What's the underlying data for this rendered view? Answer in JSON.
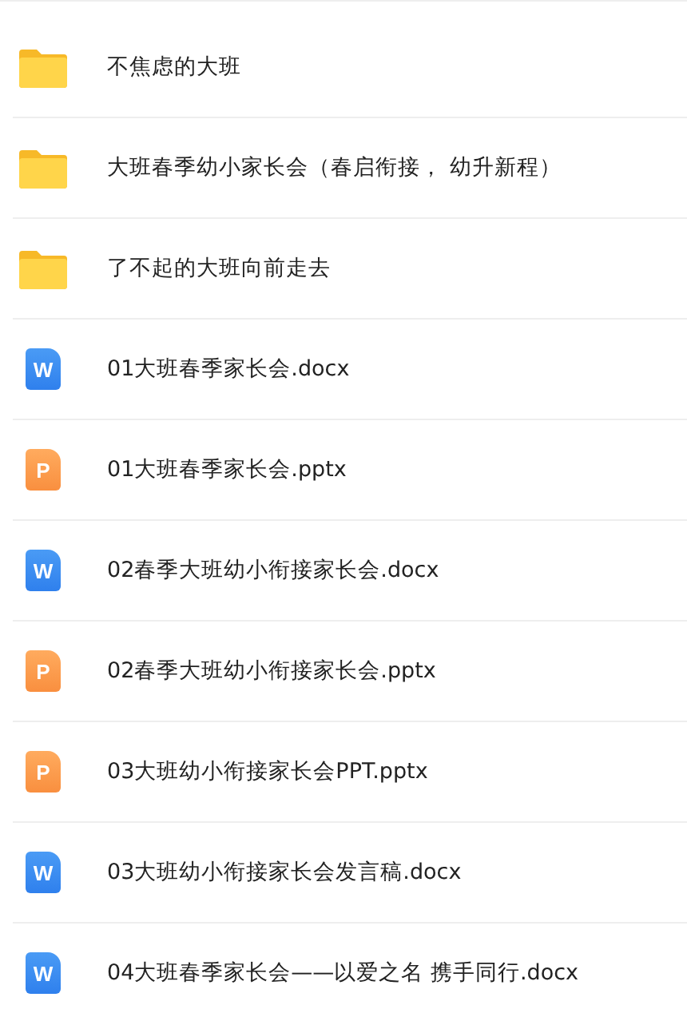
{
  "files": [
    {
      "kind": "folder",
      "name": "不焦虑的大班"
    },
    {
      "kind": "folder",
      "name": "大班春季幼小家长会（春启衔接， 幼升新程）"
    },
    {
      "kind": "folder",
      "name": "了不起的大班向前走去"
    },
    {
      "kind": "word",
      "icon_label": "W",
      "name": "01大班春季家长会.docx"
    },
    {
      "kind": "ppt",
      "icon_label": "P",
      "name": "01大班春季家长会.pptx"
    },
    {
      "kind": "word",
      "icon_label": "W",
      "name": "02春季大班幼小衔接家长会.docx"
    },
    {
      "kind": "ppt",
      "icon_label": "P",
      "name": "02春季大班幼小衔接家长会.pptx"
    },
    {
      "kind": "ppt",
      "icon_label": "P",
      "name": "03大班幼小衔接家长会PPT.pptx"
    },
    {
      "kind": "word",
      "icon_label": "W",
      "name": "03大班幼小衔接家长会发言稿.docx"
    },
    {
      "kind": "word",
      "icon_label": "W",
      "name": "04大班春季家长会——以爱之名 携手同行.docx"
    }
  ]
}
